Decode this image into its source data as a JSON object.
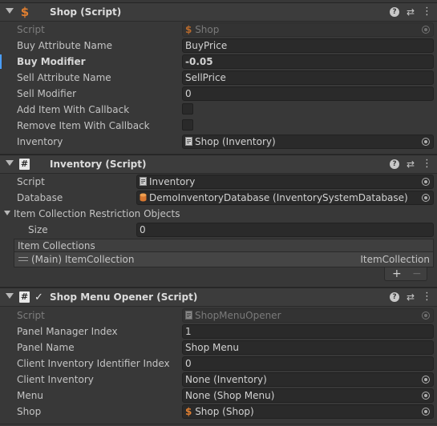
{
  "components": {
    "shop": {
      "title": "Shop (Script)",
      "rows": [
        {
          "label": "Script",
          "value": "Shop"
        },
        {
          "label": "Buy Attribute Name",
          "value": "BuyPrice"
        },
        {
          "label": "Buy Modifier",
          "value": "-0.05"
        },
        {
          "label": "Sell Attribute Name",
          "value": "SellPrice"
        },
        {
          "label": "Sell Modifier",
          "value": "0"
        },
        {
          "label": "Add Item With Callback",
          "checked": false
        },
        {
          "label": "Remove Item With Callback",
          "checked": false
        },
        {
          "label": "Inventory",
          "value": "Shop (Inventory)"
        }
      ]
    },
    "inventory": {
      "title": "Inventory (Script)",
      "rows": [
        {
          "label": "Script",
          "value": "Inventory"
        },
        {
          "label": "Database",
          "value": "DemoInventoryDatabase (InventorySystemDatabase)"
        }
      ],
      "restriction_label": "Item Collection Restriction Objects",
      "size_label": "Size",
      "size_value": "0",
      "collections_header": "Item Collections",
      "collection_item_name": "(Main) ItemCollection",
      "collection_item_type": "ItemCollection",
      "add_label": "+",
      "remove_label": "−"
    },
    "opener": {
      "title": "Shop Menu Opener (Script)",
      "enabled": true,
      "rows": [
        {
          "label": "Script",
          "value": "ShopMenuOpener"
        },
        {
          "label": "Panel Manager Index",
          "value": "1"
        },
        {
          "label": "Panel Name",
          "value": "Shop Menu"
        },
        {
          "label": "Client Inventory Identifier Index",
          "value": "0"
        },
        {
          "label": "Client Inventory",
          "value": "None (Inventory)"
        },
        {
          "label": "Menu",
          "value": "None (Shop Menu)"
        },
        {
          "label": "Shop",
          "value": "Shop (Shop)"
        }
      ]
    }
  },
  "header_icons": {
    "help": "?",
    "presets": "⇄",
    "menu": "⋮"
  },
  "colors": {
    "accent": "#4a9eff",
    "script_icon": "#e07f31"
  }
}
